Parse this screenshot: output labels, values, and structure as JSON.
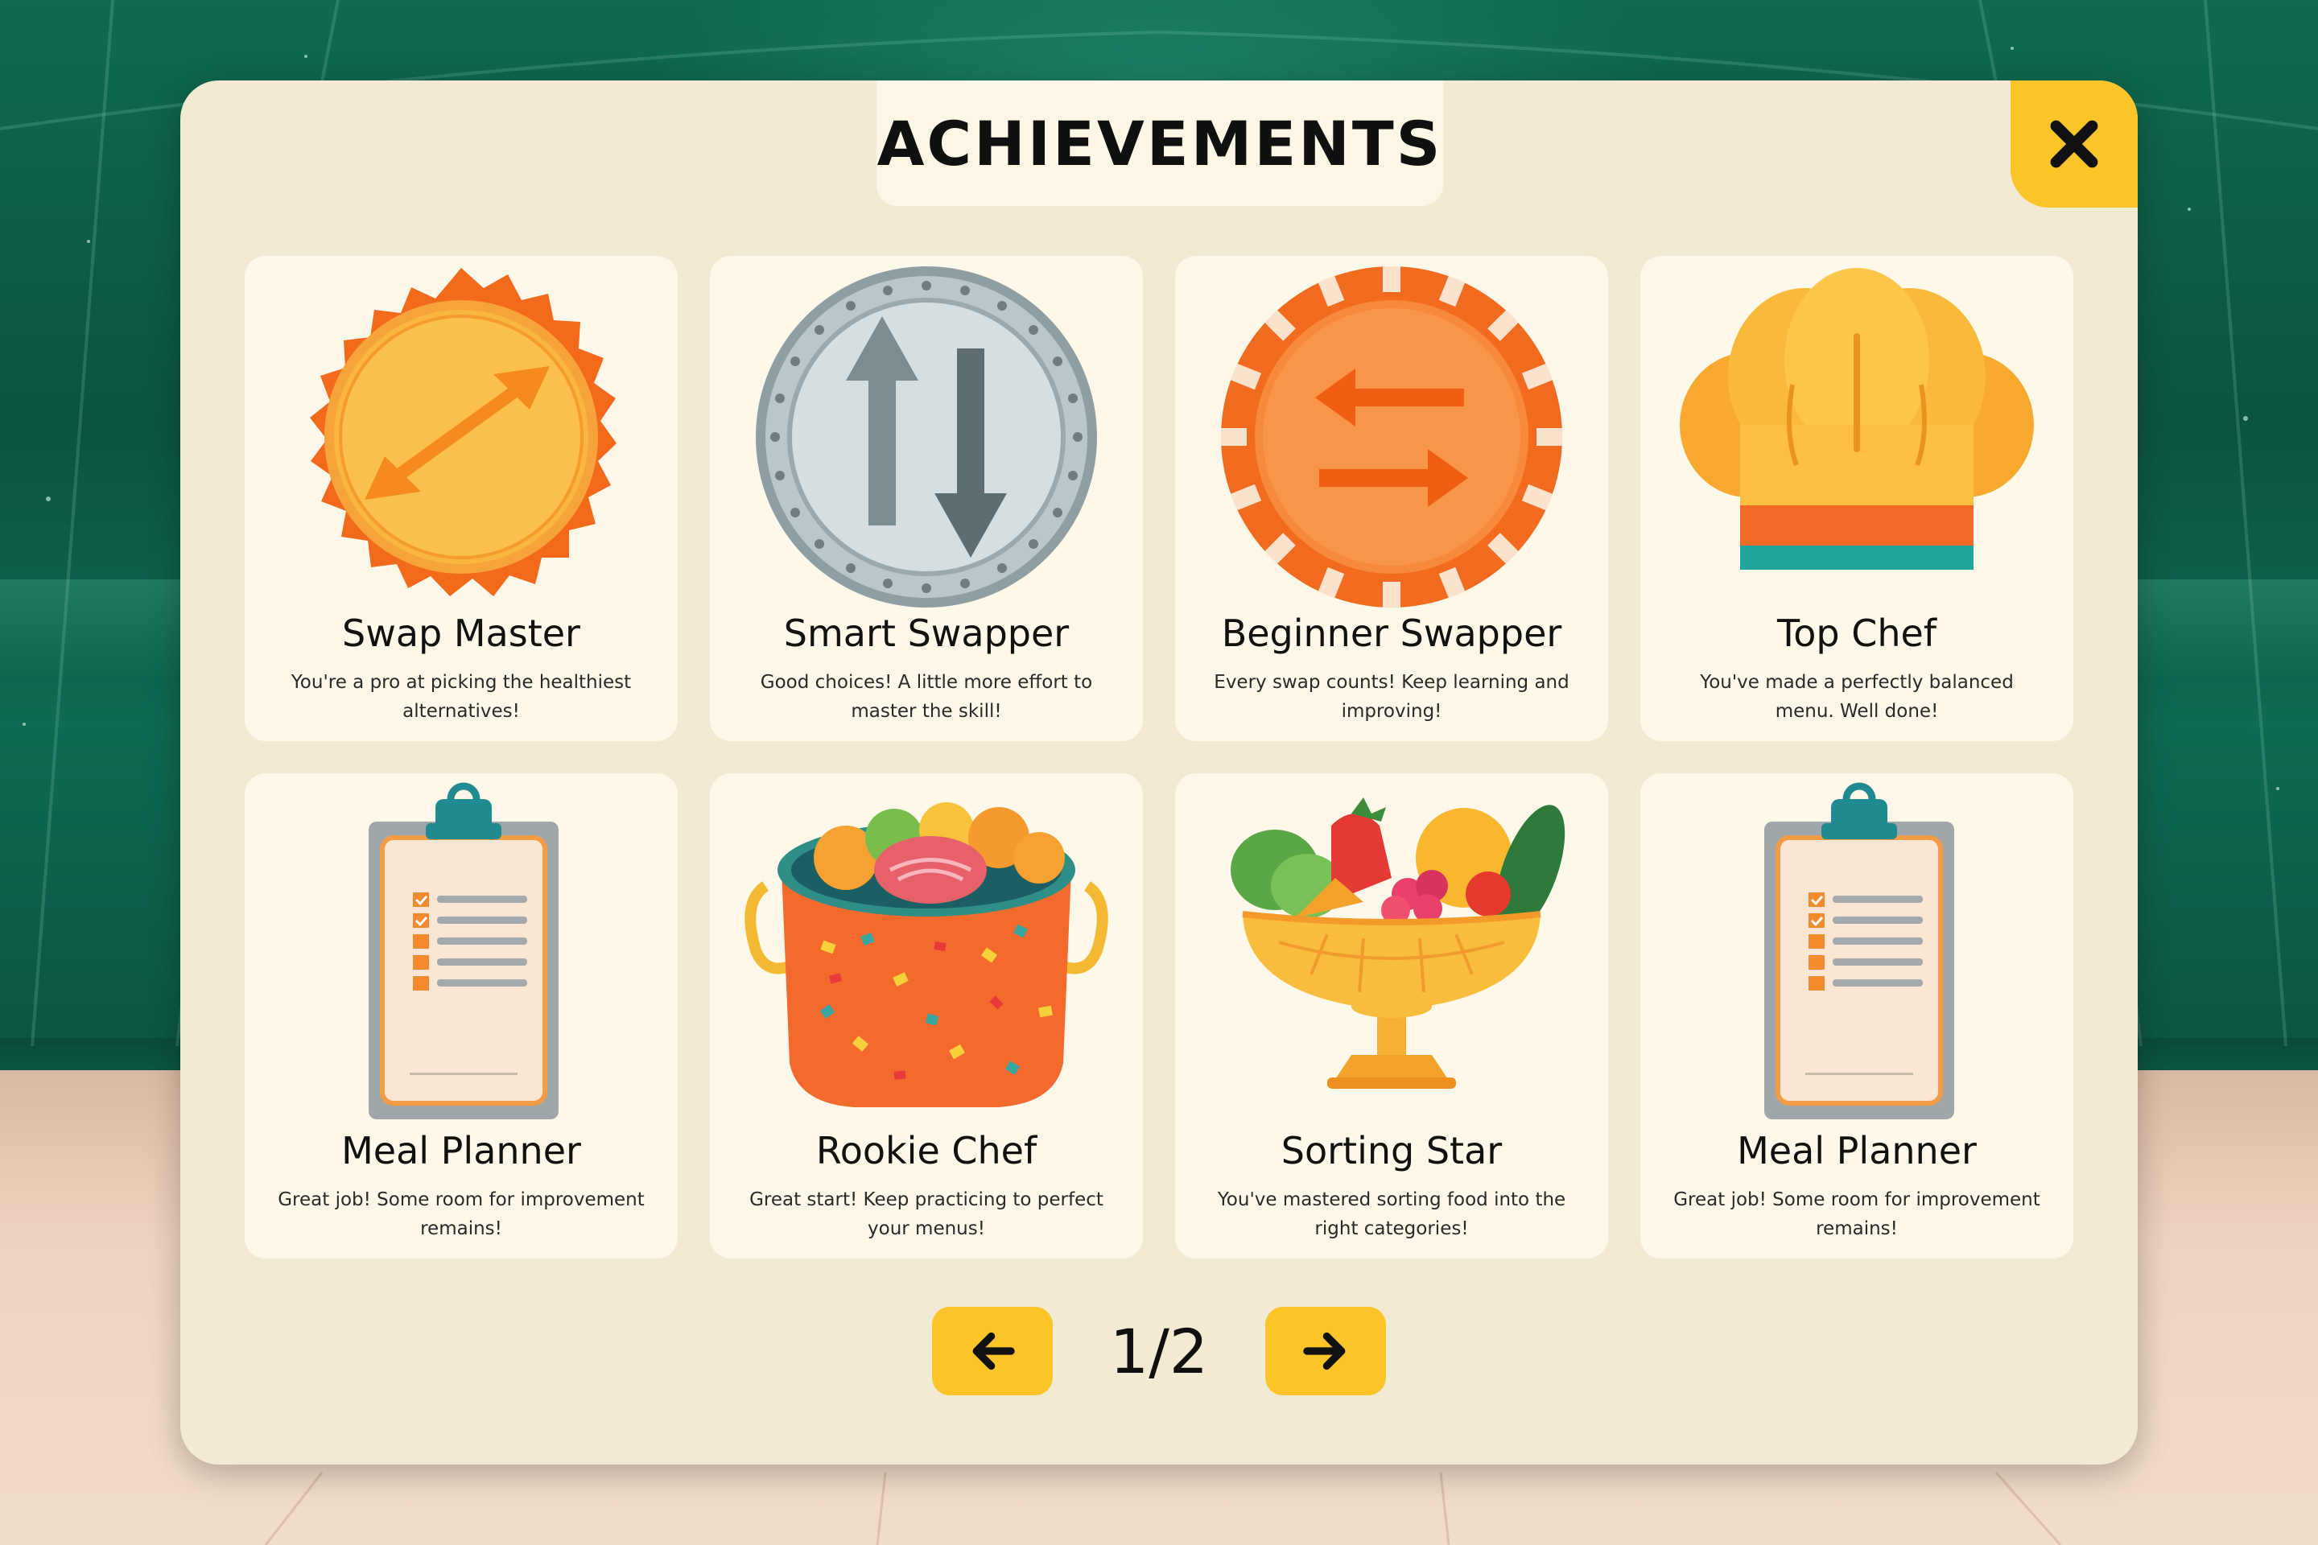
{
  "header": {
    "title": "ACHIEVEMENTS"
  },
  "close_icon": "close-icon",
  "achievements": [
    {
      "title": "Swap Master",
      "description": "You're a pro at picking the healthiest alternatives!",
      "icon": "gold-sun-medal-icon"
    },
    {
      "title": "Smart Swapper",
      "description": "Good choices! A little more effort to master the skill!",
      "icon": "silver-coin-arrows-icon"
    },
    {
      "title": "Beginner Swapper",
      "description": "Every swap counts! Keep learning and improving!",
      "icon": "orange-chip-arrows-icon"
    },
    {
      "title": "Top Chef",
      "description": "You've made a perfectly balanced menu. Well done!",
      "icon": "chef-hat-icon"
    },
    {
      "title": "Meal Planner",
      "description": "Great job! Some room for improvement remains!",
      "icon": "clipboard-checklist-icon"
    },
    {
      "title": "Rookie Chef",
      "description": "Great start! Keep practicing to perfect your menus!",
      "icon": "cooking-pot-icon"
    },
    {
      "title": "Sorting Star",
      "description": "You've mastered sorting food into the right categories!",
      "icon": "fruit-bowl-icon"
    },
    {
      "title": "Meal Planner",
      "description": "Great job! Some room for improvement remains!",
      "icon": "clipboard-checklist-icon"
    }
  ],
  "pagination": {
    "label": "1/2",
    "current": 1,
    "total": 2,
    "prev_icon": "arrow-left-icon",
    "next_icon": "arrow-right-icon"
  },
  "colors": {
    "panel": "#f3ead3",
    "card": "#fdf8ea",
    "accent": "#fbc52a",
    "text": "#101010"
  }
}
